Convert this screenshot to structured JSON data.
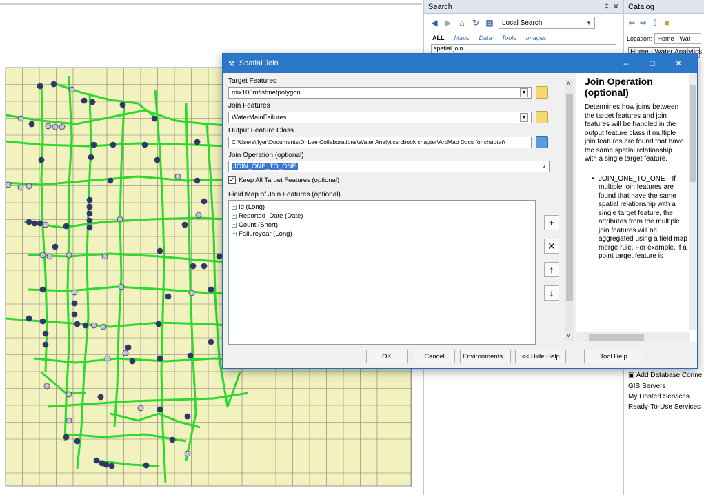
{
  "search_pane": {
    "title": "Search",
    "pin": "‡",
    "close": "✕",
    "scope": "Local Search",
    "tabs": [
      "ALL",
      "Maps",
      "Data",
      "Tools",
      "Images"
    ],
    "query": "spatial join"
  },
  "catalog_pane": {
    "title": "Catalog",
    "location_label": "Location:",
    "location_value": "Home - Wat",
    "home_item": "Home - Water Analytics",
    "tree_items": [
      "Add Database Conne",
      "GIS Servers",
      "My Hosted Services",
      "Ready-To-Use Services"
    ]
  },
  "dialog": {
    "title": "Spatial Join",
    "target_label": "Target Features",
    "target_value": "mix100mfishnetpolygon",
    "join_label": "Join Features",
    "join_value": "WaterMainFailures",
    "output_label": "Output Feature Class",
    "output_value": "C:\\Users\\flyer\\Documents\\Dr Lee Collaborations\\Water Analytics cbook chapter\\ArcMap Docs for chapter\\",
    "operation_label": "Join Operation (optional)",
    "operation_value": "JOIN_ONE_TO_ONE",
    "keep_all_label": "Keep All Target Features (optional)",
    "keep_all_checked": true,
    "fieldmap_label": "Field Map of Join Features (optional)",
    "fieldmap_items": [
      "Id (Long)",
      "Reported_Date (Date)",
      "Count (Short)",
      "Failureyear (Long)"
    ],
    "buttons": {
      "ok": "OK",
      "cancel": "Cancel",
      "environments": "Environments...",
      "hide_help": "<< Hide Help",
      "tool_help": "Tool Help"
    },
    "help": {
      "heading": "Join Operation (optional)",
      "body": "Determines how joins between the target features and join features will be handled in the output feature class if multiple join features are found that have the same spatial relationship with a single target feature.",
      "bullet": "JOIN_ONE_TO_ONE—If multiple join features are found that have the same spatial relationship with a single target feature, the attributes from the multiple join features will be aggregated using a field map merge rule. For example, if a point target feature is"
    }
  },
  "colors": {
    "map_fill": "#f2f2bf",
    "grid_line": "#7a7a7a",
    "network": "#2cd92c",
    "point_dark": "#2a3770",
    "point_light": "#c2c5d6",
    "dialog_title": "#2b78c8"
  }
}
